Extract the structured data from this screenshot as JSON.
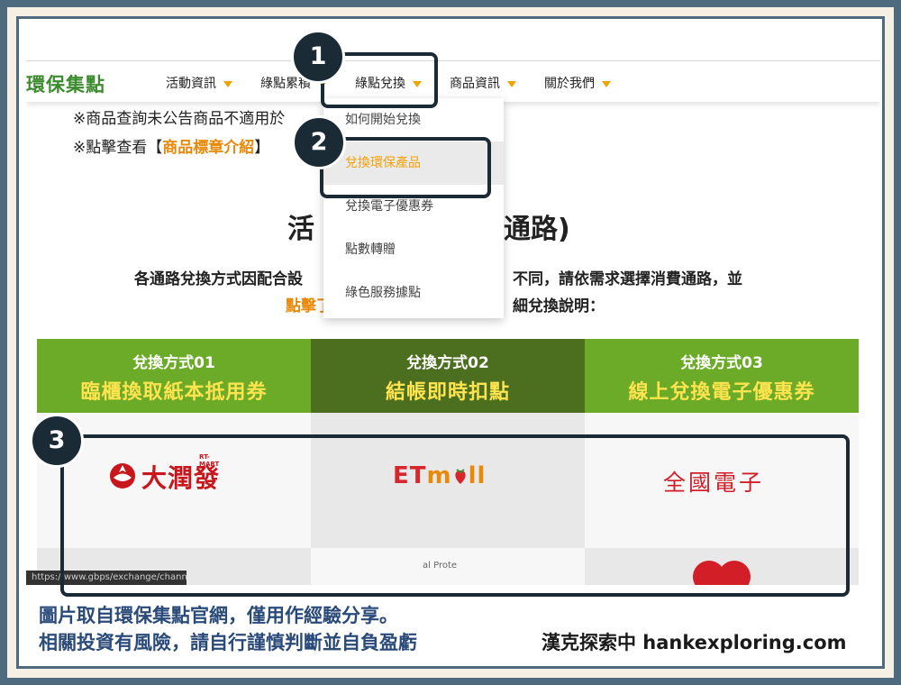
{
  "site": {
    "logo": "環保集點"
  },
  "nav": {
    "items": [
      "活動資訊",
      "綠點累積",
      "綠點兌換",
      "商品資訊",
      "關於我們"
    ]
  },
  "notes": {
    "line1": "※商品查詢未公告商品不適用於",
    "line2_prefix": "※點擊查看【",
    "line2_link": "商品標章介紹",
    "line2_suffix": "】"
  },
  "section": {
    "title_part1": "活",
    "title_part2": "通路)",
    "para1_left": "各通路兌換方式因配合設",
    "para1_right": "不同，請依需求選擇消費通路，並",
    "para2_left": "點擊了",
    "para2_right": "細兌換說明："
  },
  "dropdown": {
    "items": [
      "如何開始兌換",
      "兌換環保產品",
      "兌換電子優惠券",
      "點數轉贈",
      "綠色服務據點"
    ]
  },
  "methods": [
    {
      "label": "兌換方式01",
      "title": "臨櫃換取紙本抵用券",
      "color": "#6bab27"
    },
    {
      "label": "兌換方式02",
      "title": "結帳即時扣點",
      "color": "#4b6e1f"
    },
    {
      "label": "兌換方式03",
      "title": "線上兌換電子優惠券",
      "color": "#6bab27"
    }
  ],
  "brands": {
    "rtmart_mini": "RT-MART",
    "rtmart": "大潤發",
    "etmall_et": "ET",
    "etmall_m": "m",
    "etmall_rest": "ll",
    "tkec": "全國電子",
    "partial_text": "al Prote"
  },
  "status_url": "https://www.gbps/exchange/channel",
  "annotations": {
    "n1": "1",
    "n2": "2",
    "n3": "3"
  },
  "footer": {
    "line1": "圖片取自環保集點官網，僅用作經驗分享。",
    "line2": "相關投資有風險，請自行謹慎判斷並自負盈虧",
    "credit": "漢克探索中 hankexploring.com"
  },
  "colors": {
    "frame": "#4e6a7f",
    "annotation": "#1a2b36",
    "accent_orange": "#f0a400",
    "brand_green": "#3d8b2f"
  }
}
